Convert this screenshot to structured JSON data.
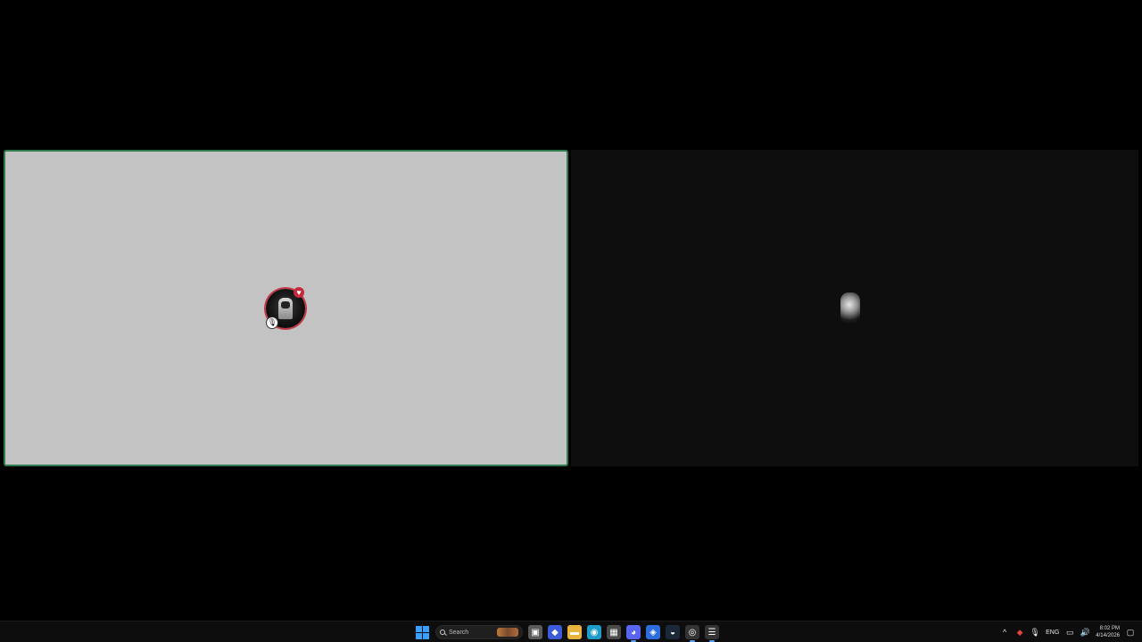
{
  "taskbar": {
    "search_placeholder": "Search",
    "pinned": [
      {
        "name": "task-view-icon",
        "glyph": "▣",
        "color": "#5a5a5a"
      },
      {
        "name": "copilot-icon",
        "glyph": "◆",
        "color": "#3b5bd9"
      },
      {
        "name": "file-explorer-icon",
        "glyph": "▬",
        "color": "#e8b33c"
      },
      {
        "name": "edge-icon",
        "glyph": "◉",
        "color": "#1e9cc9"
      },
      {
        "name": "store-icon",
        "glyph": "▦",
        "color": "#4a4a4a"
      },
      {
        "name": "discord-icon",
        "glyph": "◕",
        "color": "#5865f2"
      },
      {
        "name": "vpn-icon",
        "glyph": "◈",
        "color": "#2d6cdf"
      },
      {
        "name": "steam-icon",
        "glyph": "◒",
        "color": "#1b2838"
      },
      {
        "name": "app-icon",
        "glyph": "◎",
        "color": "#333333"
      },
      {
        "name": "notes-app-icon",
        "glyph": "☰",
        "color": "#333333"
      }
    ],
    "tray": {
      "language": "ENG",
      "time": "8:02 PM",
      "date": "4/14/2026"
    }
  }
}
